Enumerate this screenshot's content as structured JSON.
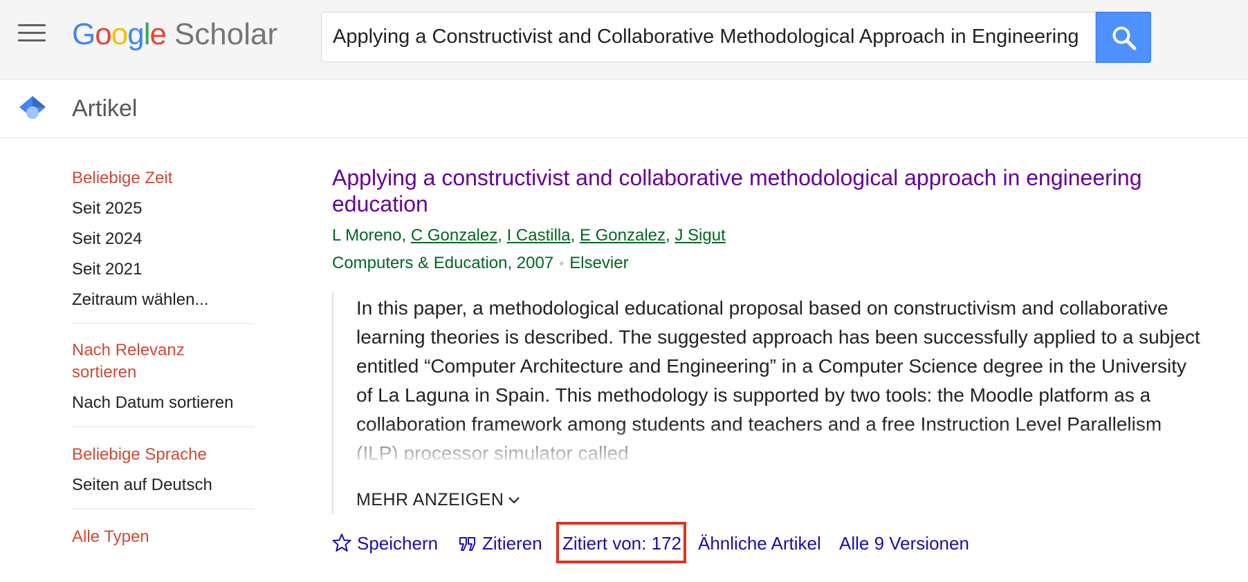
{
  "header": {
    "logo_google": "Google",
    "logo_scholar": "Scholar",
    "search_value": "Applying a Constructivist and Collaborative Methodological Approach in Engineering Education",
    "search_icon": "search-icon",
    "menu_icon": "hamburger-menu-icon"
  },
  "subbar": {
    "title": "Artikel",
    "icon": "graduation-cap-icon"
  },
  "sidebar": {
    "time": [
      "Beliebige Zeit",
      "Seit 2025",
      "Seit 2024",
      "Seit 2021",
      "Zeitraum wählen..."
    ],
    "sort": [
      "Nach Relevanz sortieren",
      "Nach Datum sortieren"
    ],
    "language": [
      "Beliebige Sprache",
      "Seiten auf Deutsch"
    ],
    "types": [
      "Alle Typen"
    ]
  },
  "result": {
    "title": "Applying a constructivist and collaborative methodological approach in engineering education",
    "authors": [
      "L Moreno",
      "C Gonzalez",
      "I Castilla",
      "E Gonzalez",
      "J Sigut"
    ],
    "author_sep": ", ",
    "source_journal": "Computers & Education, 2007",
    "source_dot": "•",
    "source_publisher": "Elsevier",
    "abstract": "In this paper, a methodological educational proposal based on constructivism and collaborative learning theories is described. The suggested approach has been successfully applied to a subject entitled “Computer Architecture and Engineering” in a Computer Science degree in the University of La Laguna in Spain. This methodology is supported by two tools: the Moodle platform as a collaboration framework among students and teachers and a free Instruction Level Parallelism (ILP) processor simulator called",
    "more_label": "MEHR ANZEIGEN",
    "actions": {
      "save": "Speichern",
      "cite": "Zitieren",
      "cited_by": "Zitiert von: 172",
      "related": "Ähnliche Artikel",
      "versions": "Alle 9 Versionen"
    }
  },
  "colors": {
    "accent_blue": "#4d90fe",
    "active_red": "#d14836",
    "title_purple": "#660099",
    "green": "#006621",
    "link_blue": "#1a0dab",
    "highlight_red": "#e0321c"
  }
}
